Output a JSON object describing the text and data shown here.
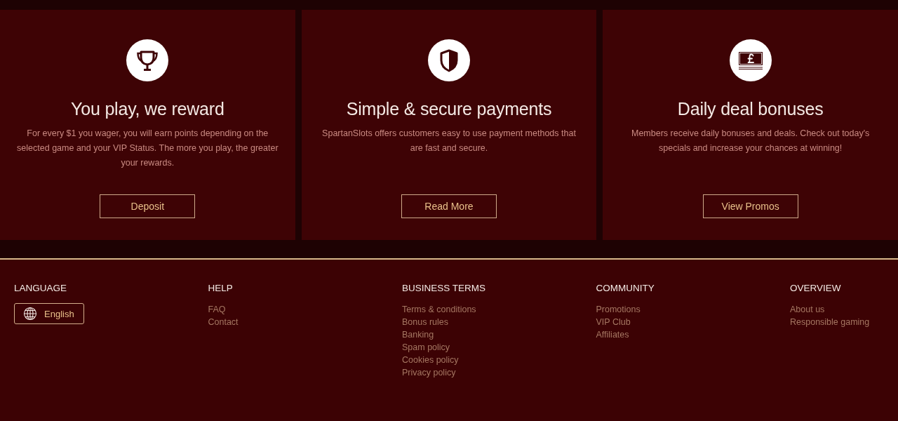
{
  "features": [
    {
      "kind": "rewards",
      "title": "You play, we reward",
      "description": "For every $1 you wager, you will earn points depending on the selected game and your VIP Status. The more you play, the greater your rewards.",
      "button": "Deposit"
    },
    {
      "kind": "payments",
      "title": "Simple & secure payments",
      "description": "SpartanSlots offers customers easy to use payment methods that are fast and secure.",
      "button": "Read More"
    },
    {
      "kind": "bonuses",
      "title": "Daily deal bonuses",
      "description": "Members receive daily bonuses and deals. Check out today's specials and increase your chances at winning!",
      "button": "View Promos"
    }
  ],
  "footer": {
    "language": {
      "heading": "LANGUAGE",
      "selector": "English"
    },
    "columns": [
      {
        "heading": "HELP",
        "links": [
          "FAQ",
          "Contact"
        ]
      },
      {
        "heading": "BUSINESS TERMS",
        "links": [
          "Terms & conditions",
          "Bonus rules",
          "Banking",
          "Spam policy",
          "Cookies policy",
          "Privacy policy"
        ]
      },
      {
        "heading": "COMMUNITY",
        "links": [
          "Promotions",
          "VIP Club",
          "Affiliates"
        ]
      },
      {
        "heading": "OVERVIEW",
        "links": [
          "About us",
          "Responsible gaming"
        ]
      }
    ]
  }
}
